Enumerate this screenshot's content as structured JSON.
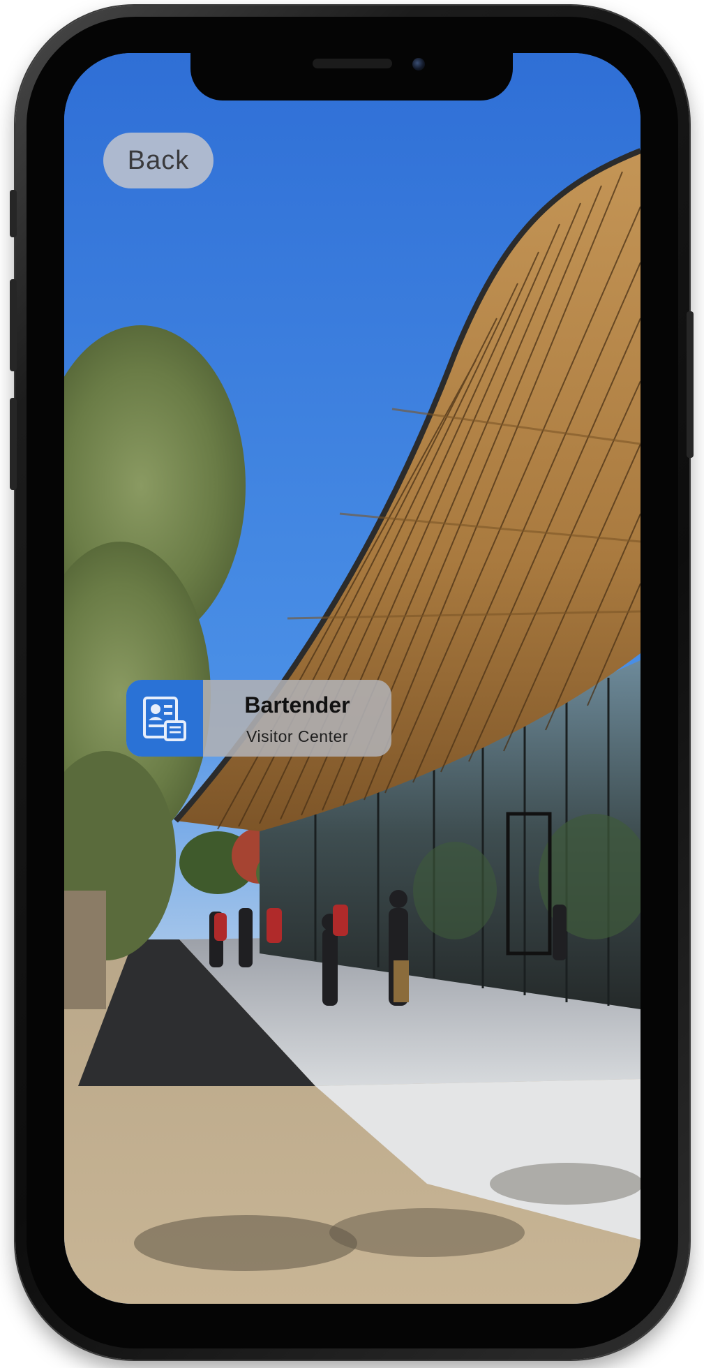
{
  "navigation": {
    "back_label": "Back"
  },
  "poi_card": {
    "title": "Bartender",
    "subtitle": "Visitor Center",
    "icon": "contact-card-icon",
    "accent_color": "#2a72d6"
  },
  "device": {
    "model": "iphone-x-frame",
    "frame_color": "#111111"
  },
  "scene": {
    "sky_color": "#3b7fdc"
  }
}
